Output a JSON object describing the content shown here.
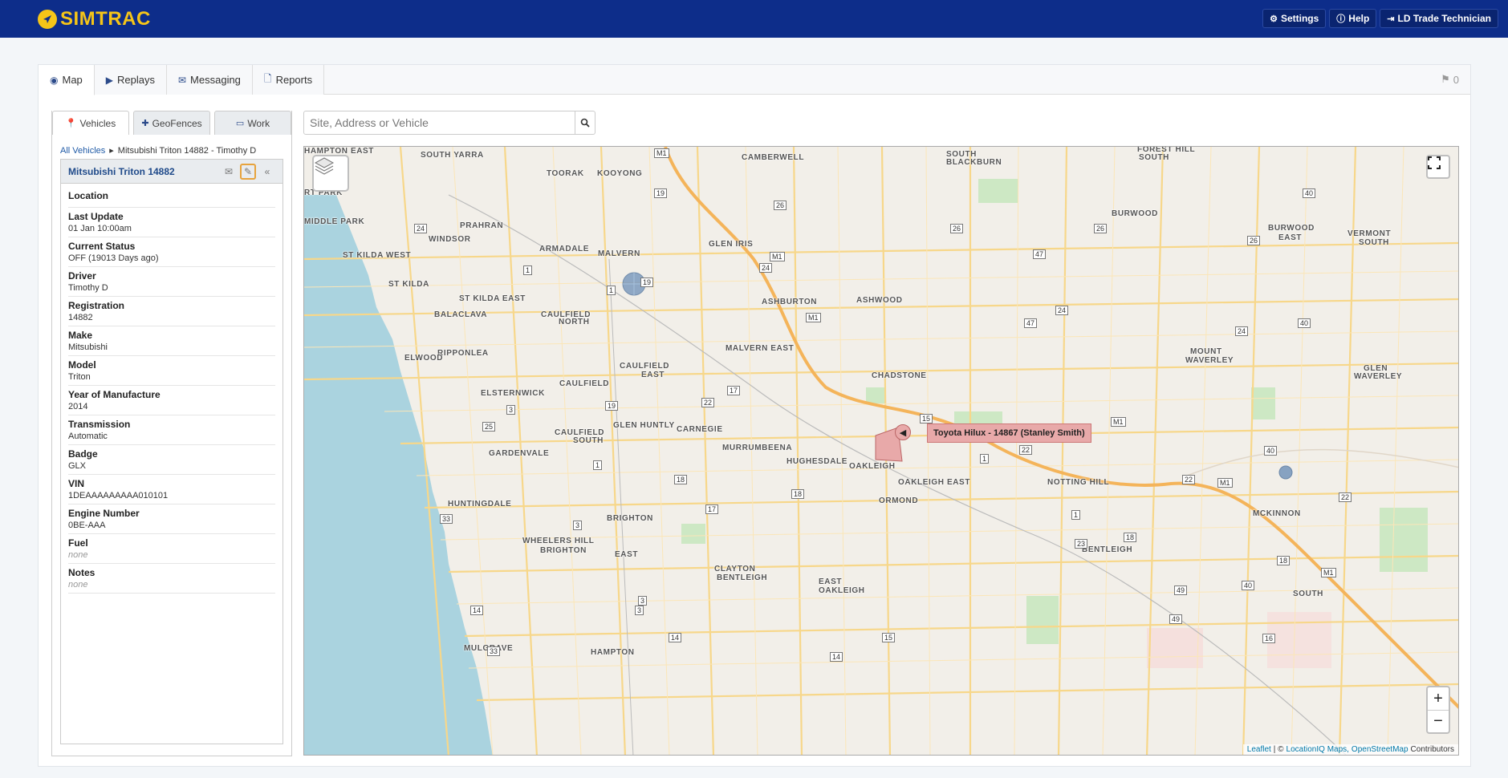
{
  "header": {
    "brand": "SIMTRAC",
    "buttons": [
      {
        "label": "Settings",
        "icon": "gear-icon"
      },
      {
        "label": "Help",
        "icon": "info-icon"
      },
      {
        "label": "LD Trade Technician",
        "icon": "sign-out-icon"
      }
    ]
  },
  "tabs": [
    {
      "label": "Map",
      "icon": "globe-icon",
      "active": true
    },
    {
      "label": "Replays",
      "icon": "play-icon"
    },
    {
      "label": "Messaging",
      "icon": "envelope-icon"
    },
    {
      "label": "Reports",
      "icon": "file-icon"
    }
  ],
  "flag_count": "0",
  "subtabs": [
    {
      "label": "Vehicles",
      "icon": "map-marker-icon",
      "active": true
    },
    {
      "label": "GeoFences",
      "icon": "plus-icon"
    },
    {
      "label": "Work",
      "icon": "desktop-icon"
    }
  ],
  "breadcrumb": {
    "root": "All Vehicles",
    "current": "Mitsubishi Triton 14882 - Timothy D"
  },
  "vehicle": {
    "title": "Mitsubishi Triton 14882",
    "fields": [
      {
        "label": "Location",
        "value": ""
      },
      {
        "label": "Last Update",
        "value": "01 Jan 10:00am"
      },
      {
        "label": "Current Status",
        "value": "OFF (19013 Days ago)"
      },
      {
        "label": "Driver",
        "value": "Timothy D"
      },
      {
        "label": "Registration",
        "value": "14882"
      },
      {
        "label": "Make",
        "value": "Mitsubishi"
      },
      {
        "label": "Model",
        "value": "Triton"
      },
      {
        "label": "Year of Manufacture",
        "value": "2014"
      },
      {
        "label": "Transmission",
        "value": "Automatic"
      },
      {
        "label": "Badge",
        "value": "GLX"
      },
      {
        "label": "VIN",
        "value": "1DEAAAAAAAAA010101"
      },
      {
        "label": "Engine Number",
        "value": "0BE-AAA"
      },
      {
        "label": "Fuel",
        "value": "none"
      },
      {
        "label": "Notes",
        "value": "none"
      }
    ]
  },
  "search": {
    "placeholder": "Site, Address or Vehicle",
    "value": ""
  },
  "map": {
    "tooltip": "Toyota Hilux - 14867 (Stanley Smith)",
    "zoom_in": "+",
    "zoom_out": "−",
    "attribution": {
      "leaflet": "Leaflet",
      "sep": "| ©",
      "liq": "LocationIQ Maps,",
      "osm": "OpenStreetMap",
      "contrib": "Contributors"
    },
    "suburbs": [
      "SOUTH YARRA",
      "TOORAK",
      "KOOYONG",
      "CAMBERWELL",
      "SOUTH",
      "BLACKBURN",
      "SOUTH",
      "FOREST HILL",
      "RT PARK",
      "MIDDLE PARK",
      "PRAHRAN",
      "WINDSOR",
      "ARMADALE",
      "MALVERN",
      "GLEN IRIS",
      "BURWOOD",
      "BURWOOD",
      "EAST",
      "VERMONT",
      "SOUTH",
      "ST KILDA WEST",
      "ST KILDA",
      "ST KILDA EAST",
      "CAULFIELD",
      "NORTH",
      "ASHBURTON",
      "ASHWOOD",
      "BALACLAVA",
      "RIPPONLEA",
      "ELWOOD",
      "MALVERN EAST",
      "MOUNT",
      "WAVERLEY",
      "GLEN",
      "WAVERLEY",
      "CAULFIELD",
      "EAST",
      "CHADSTONE",
      "CAULFIELD",
      "ELSTERNWICK",
      "GLEN HUNTLY",
      "CARNEGIE",
      "CAULFIELD",
      "SOUTH",
      "MURRUMBEENA",
      "HUGHESDALE",
      "OAKLEIGH",
      "GARDENVALE",
      "OAKLEIGH EAST",
      "NOTTING HILL",
      "ORMOND",
      "HUNTINGDALE",
      "BRIGHTON",
      "MCKINNON",
      "WHEELERS HILL",
      "BRIGHTON",
      "EAST",
      "BENTLEIGH",
      "CLAYTON",
      "BENTLEIGH",
      "EAST",
      "OAKLEIGH",
      "SOUTH",
      "MULGRAVE",
      "HAMPTON",
      "HAMPTON EAST"
    ]
  }
}
